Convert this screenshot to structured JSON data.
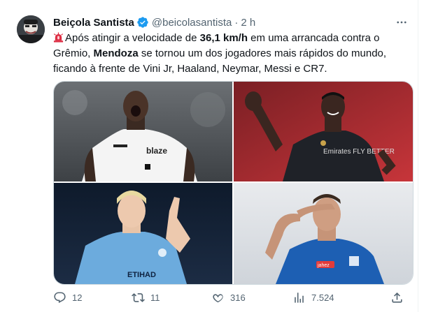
{
  "author": {
    "name": "Beiçola Santista",
    "handle": "@beicolasantista",
    "separator": "·",
    "time": "2 h"
  },
  "tweet": {
    "parts": [
      {
        "text": "Após atingir a velocidade de ",
        "bold": false
      },
      {
        "text": "36,1 km/h",
        "bold": true
      },
      {
        "text": " em uma arrancada contra o Grêmio, ",
        "bold": false
      },
      {
        "text": "Mendoza",
        "bold": true
      },
      {
        "text": " se tornou um dos jogadores mais rápidos do mundo, ficando à frente de Vini Jr, Haaland, Neymar, Messi e CR7.",
        "bold": false
      }
    ]
  },
  "media": {
    "images": [
      {
        "jersey_text": "blaze"
      },
      {
        "jersey_text": "Emirates FLY BETTER"
      },
      {
        "jersey_text": "ETIHAD"
      },
      {
        "jersey_text": "jahez"
      }
    ]
  },
  "actions": {
    "replies": "12",
    "reposts": "11",
    "likes": "316",
    "views": "7.524"
  },
  "colors": {
    "text": "#0f1419",
    "muted": "#536471",
    "verified": "#1d9bf0",
    "border": "#cfd9de"
  }
}
